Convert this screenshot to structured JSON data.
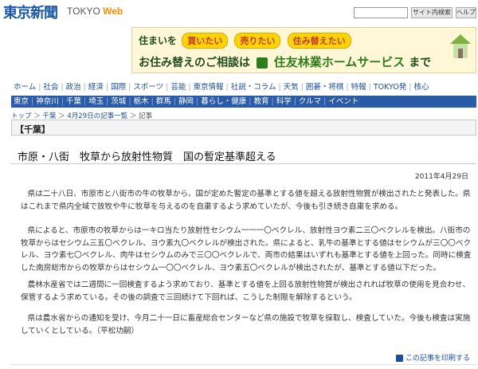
{
  "header": {
    "logo_jp": "東京新聞",
    "logo_en": "TOKYO",
    "logo_web": "Web",
    "site_search_label": "サイト内検索",
    "help_label": "ヘルプ",
    "search_placeholder": ""
  },
  "banner": {
    "lead": "住まいを",
    "pill1": "買いたい",
    "pill2": "売りたい",
    "pill3": "住み替えたい",
    "consult": "お住み替えのご相談は",
    "company": "住友林業ホームサービス",
    "suffix": "まで"
  },
  "nav_primary": [
    "ホーム",
    "社会",
    "政治",
    "経済",
    "国際",
    "スポーツ",
    "芸能",
    "東京情報",
    "社説・コラム",
    "天気",
    "囲碁・将棋",
    "特報",
    "TOKYO発",
    "核心"
  ],
  "nav_secondary": [
    "東京",
    "神奈川",
    "千葉",
    "埼玉",
    "茨城",
    "栃木",
    "群馬",
    "静岡",
    "暮らし・健康",
    "教育",
    "科学",
    "クルマ",
    "イベント"
  ],
  "breadcrumb": {
    "items": [
      "トップ",
      "千葉",
      "4月29日の記事一覧",
      "記事"
    ],
    "separator": "＞"
  },
  "section": "【千葉】",
  "article": {
    "title": "市原・八街　牧草から放射性物質　国の暫定基準超える",
    "date": "2011年4月29日",
    "paragraphs": [
      "県は二十八日、市原市と八街市の牛の牧草から、国が定めた暫定の基準とする値を超える放射性物質が検出されたと発表した。県はこれまで県内全域で放牧や牛に牧草を与えるのを自粛するよう求めていたが、今後も引き続き自粛を求める。",
      "県によると、市原市の牧草からは一キロ当たり放射性セシウム一一一〇ベクレル、放射性ヨウ素二三〇ベクレルを検出。八街市の牧草からはセシウム三五〇ベクレル、ヨウ素九〇ベクレルが検出された。県によると、乳牛の基準とする値はセシウムが三〇〇ベクレル、ヨウ素七〇ベクレル、肉牛はセシウムのみで三〇〇ベクレルで、両市の結果はいずれも基準とする値を上回った。同時に検査した南房総市からの牧草からはセシウム一〇〇ベクレル、ヨウ素五〇ベクレルが検出されたが、基準とする値以下だった。",
      "農林水産省では二週間に一回検査するよう求めており、基準とする値を上回る放射性物質が検出されれば牧草の使用を見合わせ、保管するよう求めている。その後の調査で三回続けて下回れば、こうした制限を解除するという。",
      "県は農水省からの通知を受け、今月二十一日に畜産総合センターなど県の施設で牧草を採取し、検査していた。今後も検査は実施していくとしている。（平松功嗣）"
    ]
  },
  "print_link": "この記事を印刷する",
  "colors": {
    "brand_blue": "#1a57a6",
    "nav_blue": "#2a5ba8",
    "web_orange": "#ff8a00",
    "banner_green": "#2e7d1c"
  }
}
